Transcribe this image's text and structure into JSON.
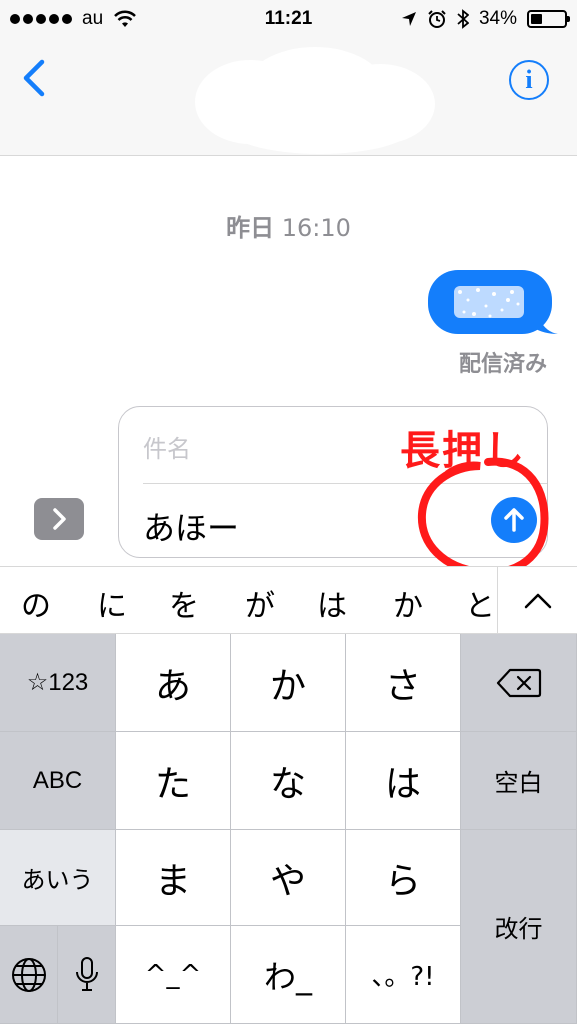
{
  "status_bar": {
    "carrier": "au",
    "time": "11:21",
    "battery_percent": "34%",
    "battery_level": 0.34,
    "icons": [
      "signal-dots",
      "wifi-icon",
      "location-arrow-icon",
      "alarm-icon",
      "bluetooth-icon",
      "battery-icon"
    ]
  },
  "nav": {
    "back_icon": "chevron-left-icon",
    "info_label": "i",
    "accent_color": "#147efb"
  },
  "conversation": {
    "timestamp_day": "昨日",
    "timestamp_time": "16:10",
    "delivered_label": "配信済み"
  },
  "compose": {
    "subject_placeholder": "件名",
    "message_text": "あほー",
    "send_icon": "arrow-up-icon"
  },
  "annotation": {
    "text": "長押し",
    "color": "#ff1a1a"
  },
  "candidates": {
    "items": [
      "の",
      "に",
      "を",
      "が",
      "は",
      "か",
      "と"
    ],
    "expand_icon": "chevron-up-icon"
  },
  "keyboard": {
    "numbers_key": "☆123",
    "abc_key": "ABC",
    "kana_key": "あいう",
    "row1": [
      "あ",
      "か",
      "さ"
    ],
    "row2": [
      "た",
      "な",
      "は"
    ],
    "row3": [
      "ま",
      "や",
      "ら"
    ],
    "row4": [
      "^_^",
      "わ_",
      "、。?!"
    ],
    "space_key": "空白",
    "return_key": "改行",
    "delete_icon": "backspace-icon",
    "globe_icon": "globe-icon",
    "mic_icon": "microphone-icon"
  }
}
